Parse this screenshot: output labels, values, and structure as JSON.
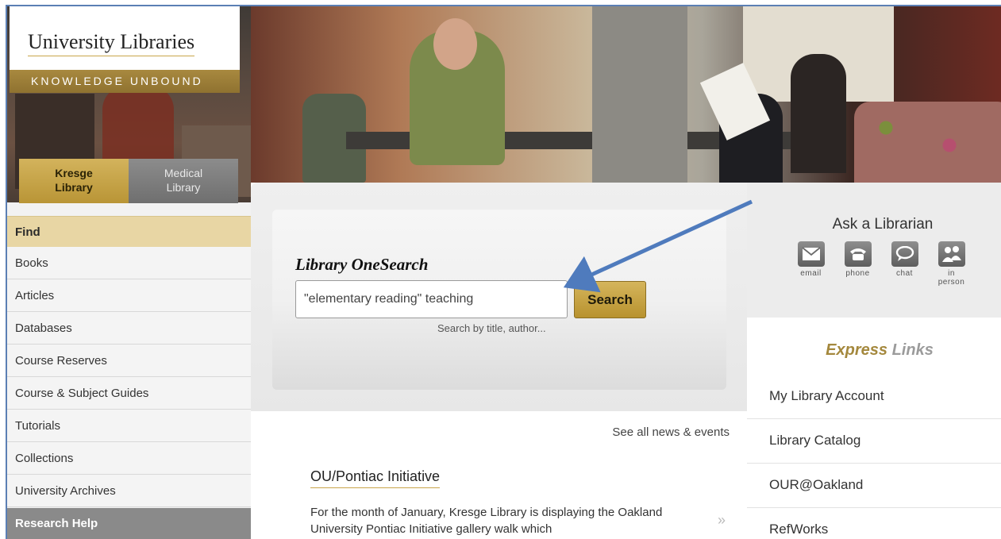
{
  "branding": {
    "title": "University Libraries",
    "tagline": "KNOWLEDGE UNBOUND"
  },
  "library_tabs": [
    {
      "label_line1": "Kresge",
      "label_line2": "Library",
      "active": true
    },
    {
      "label_line1": "Medical",
      "label_line2": "Library",
      "active": false
    }
  ],
  "nav": {
    "find_heading": "Find",
    "items": [
      "Books",
      "Articles",
      "Databases",
      "Course Reserves",
      "Course & Subject Guides",
      "Tutorials",
      "Collections",
      "University Archives"
    ],
    "research_heading": "Research Help"
  },
  "search": {
    "label": "Library OneSearch",
    "value": "\"elementary reading\" teaching",
    "button_label": "Search",
    "hint": "Search by title, author..."
  },
  "news": {
    "see_all": "See all news & events",
    "title": "OU/Pontiac Initiative",
    "body": "For the month of January, Kresge Library is displaying the Oakland University Pontiac Initiative gallery walk which",
    "chevron": "»"
  },
  "ask": {
    "title": "Ask a Librarian",
    "options": [
      {
        "label": "email",
        "icon": "email-icon"
      },
      {
        "label": "phone",
        "icon": "phone-icon"
      },
      {
        "label": "chat",
        "icon": "chat-icon"
      },
      {
        "label": "in person",
        "icon": "in-person-icon"
      }
    ]
  },
  "express": {
    "title_part1": "Express",
    "title_part2": "Links",
    "items": [
      "My Library Account",
      "Library Catalog",
      "OUR@Oakland",
      "RefWorks"
    ]
  },
  "colors": {
    "gold": "#b99536",
    "find_bg": "#e8d6a4",
    "annotation_arrow": "#4f7bbd"
  }
}
